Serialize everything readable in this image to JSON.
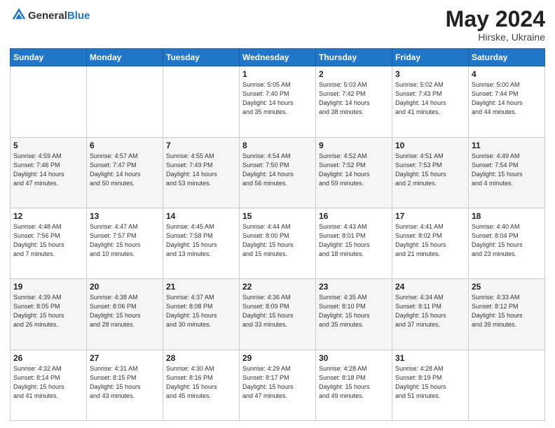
{
  "header": {
    "logo_general": "General",
    "logo_blue": "Blue",
    "month_title": "May 2024",
    "location": "Hirske, Ukraine"
  },
  "days_of_week": [
    "Sunday",
    "Monday",
    "Tuesday",
    "Wednesday",
    "Thursday",
    "Friday",
    "Saturday"
  ],
  "weeks": [
    [
      {
        "day": "",
        "info": ""
      },
      {
        "day": "",
        "info": ""
      },
      {
        "day": "",
        "info": ""
      },
      {
        "day": "1",
        "info": "Sunrise: 5:05 AM\nSunset: 7:40 PM\nDaylight: 14 hours\nand 35 minutes."
      },
      {
        "day": "2",
        "info": "Sunrise: 5:03 AM\nSunset: 7:42 PM\nDaylight: 14 hours\nand 38 minutes."
      },
      {
        "day": "3",
        "info": "Sunrise: 5:02 AM\nSunset: 7:43 PM\nDaylight: 14 hours\nand 41 minutes."
      },
      {
        "day": "4",
        "info": "Sunrise: 5:00 AM\nSunset: 7:44 PM\nDaylight: 14 hours\nand 44 minutes."
      }
    ],
    [
      {
        "day": "5",
        "info": "Sunrise: 4:59 AM\nSunset: 7:46 PM\nDaylight: 14 hours\nand 47 minutes."
      },
      {
        "day": "6",
        "info": "Sunrise: 4:57 AM\nSunset: 7:47 PM\nDaylight: 14 hours\nand 50 minutes."
      },
      {
        "day": "7",
        "info": "Sunrise: 4:55 AM\nSunset: 7:49 PM\nDaylight: 14 hours\nand 53 minutes."
      },
      {
        "day": "8",
        "info": "Sunrise: 4:54 AM\nSunset: 7:50 PM\nDaylight: 14 hours\nand 56 minutes."
      },
      {
        "day": "9",
        "info": "Sunrise: 4:52 AM\nSunset: 7:52 PM\nDaylight: 14 hours\nand 59 minutes."
      },
      {
        "day": "10",
        "info": "Sunrise: 4:51 AM\nSunset: 7:53 PM\nDaylight: 15 hours\nand 2 minutes."
      },
      {
        "day": "11",
        "info": "Sunrise: 4:49 AM\nSunset: 7:54 PM\nDaylight: 15 hours\nand 4 minutes."
      }
    ],
    [
      {
        "day": "12",
        "info": "Sunrise: 4:48 AM\nSunset: 7:56 PM\nDaylight: 15 hours\nand 7 minutes."
      },
      {
        "day": "13",
        "info": "Sunrise: 4:47 AM\nSunset: 7:57 PM\nDaylight: 15 hours\nand 10 minutes."
      },
      {
        "day": "14",
        "info": "Sunrise: 4:45 AM\nSunset: 7:58 PM\nDaylight: 15 hours\nand 13 minutes."
      },
      {
        "day": "15",
        "info": "Sunrise: 4:44 AM\nSunset: 8:00 PM\nDaylight: 15 hours\nand 15 minutes."
      },
      {
        "day": "16",
        "info": "Sunrise: 4:43 AM\nSunset: 8:01 PM\nDaylight: 15 hours\nand 18 minutes."
      },
      {
        "day": "17",
        "info": "Sunrise: 4:41 AM\nSunset: 8:02 PM\nDaylight: 15 hours\nand 21 minutes."
      },
      {
        "day": "18",
        "info": "Sunrise: 4:40 AM\nSunset: 8:04 PM\nDaylight: 15 hours\nand 23 minutes."
      }
    ],
    [
      {
        "day": "19",
        "info": "Sunrise: 4:39 AM\nSunset: 8:05 PM\nDaylight: 15 hours\nand 26 minutes."
      },
      {
        "day": "20",
        "info": "Sunrise: 4:38 AM\nSunset: 8:06 PM\nDaylight: 15 hours\nand 28 minutes."
      },
      {
        "day": "21",
        "info": "Sunrise: 4:37 AM\nSunset: 8:08 PM\nDaylight: 15 hours\nand 30 minutes."
      },
      {
        "day": "22",
        "info": "Sunrise: 4:36 AM\nSunset: 8:09 PM\nDaylight: 15 hours\nand 33 minutes."
      },
      {
        "day": "23",
        "info": "Sunrise: 4:35 AM\nSunset: 8:10 PM\nDaylight: 15 hours\nand 35 minutes."
      },
      {
        "day": "24",
        "info": "Sunrise: 4:34 AM\nSunset: 8:11 PM\nDaylight: 15 hours\nand 37 minutes."
      },
      {
        "day": "25",
        "info": "Sunrise: 4:33 AM\nSunset: 8:12 PM\nDaylight: 15 hours\nand 39 minutes."
      }
    ],
    [
      {
        "day": "26",
        "info": "Sunrise: 4:32 AM\nSunset: 8:14 PM\nDaylight: 15 hours\nand 41 minutes."
      },
      {
        "day": "27",
        "info": "Sunrise: 4:31 AM\nSunset: 8:15 PM\nDaylight: 15 hours\nand 43 minutes."
      },
      {
        "day": "28",
        "info": "Sunrise: 4:30 AM\nSunset: 8:16 PM\nDaylight: 15 hours\nand 45 minutes."
      },
      {
        "day": "29",
        "info": "Sunrise: 4:29 AM\nSunset: 8:17 PM\nDaylight: 15 hours\nand 47 minutes."
      },
      {
        "day": "30",
        "info": "Sunrise: 4:28 AM\nSunset: 8:18 PM\nDaylight: 15 hours\nand 49 minutes."
      },
      {
        "day": "31",
        "info": "Sunrise: 4:28 AM\nSunset: 8:19 PM\nDaylight: 15 hours\nand 51 minutes."
      },
      {
        "day": "",
        "info": ""
      }
    ]
  ]
}
